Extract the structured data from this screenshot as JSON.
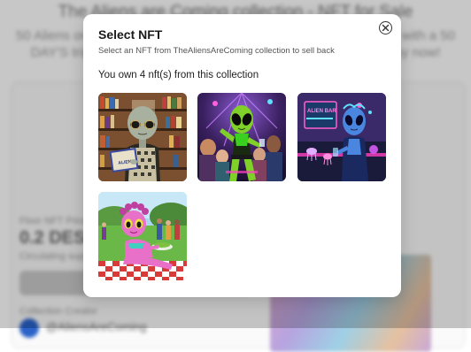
{
  "background": {
    "title": "The Aliens are Coming collection - NFT for Sale",
    "subtitle_line1": "50 Aliens on Tour! Explore collection of 50 unique aliens depicted with a 50",
    "subtitle_line2": "DAY'S trip on Earth. Own a rare piece of the alien invasion - Buy now!",
    "price_label": "Floor NFT Price",
    "price_value": "0.2 DESO",
    "price_note": "Circulating supply",
    "creator_label": "Collection Creator",
    "creator_name": "@AliensAreComing"
  },
  "modal": {
    "title": "Select NFT",
    "subtitle": "Select an NFT from TheAliensAreComing collection to sell back",
    "owned_text": "You own 4 nft(s) from this collection",
    "close_icon": "close-circle-icon",
    "nfts": [
      {
        "name": "alien-librarian",
        "book_text": "ALIEN"
      },
      {
        "name": "alien-nightclub-dancer"
      },
      {
        "name": "alien-neon-bar",
        "sign_text": "ALIEN BAR"
      },
      {
        "name": "alien-picnic"
      }
    ]
  },
  "colors": {
    "overlay": "rgba(0,0,0,0.22)",
    "modal_bg": "#ffffff",
    "alien_green": "#7fd12a",
    "alien_blue": "#4a86e0",
    "alien_pink": "#e870c8"
  }
}
